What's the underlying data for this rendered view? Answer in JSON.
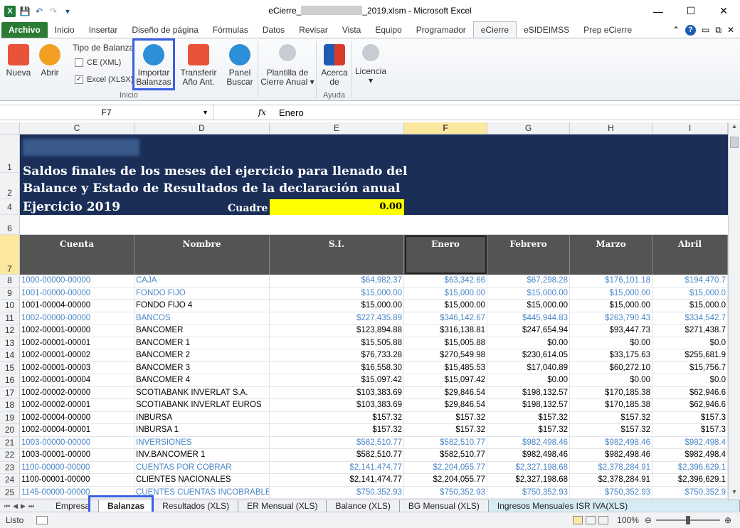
{
  "titlebar": {
    "title_prefix": "eCierre_",
    "title_suffix": "_2019.xlsm - Microsoft Excel",
    "min": "—",
    "max": "☐",
    "close": "✕"
  },
  "tabs": [
    "Archivo",
    "Inicio",
    "Insertar",
    "Diseño de página",
    "Fórmulas",
    "Datos",
    "Revisar",
    "Vista",
    "Equipo",
    "Programador",
    "eCierre",
    "eSIDEIMSS",
    "Prep eCierre"
  ],
  "ribbon": {
    "nueva": "Nueva",
    "abrir": "Abrir",
    "tipo_balanza": "Tipo de Balanza",
    "ce_xml": "CE (XML)",
    "excel_xlsx": "Excel (XLSX)",
    "inicio_group": "Inicio",
    "importar_l1": "Importar",
    "importar_l2": "Balanzas",
    "transferir_l1": "Transferir",
    "transferir_l2": "Año Ant.",
    "panel_l1": "Panel",
    "panel_l2": "Buscar",
    "plantilla_l1": "Plantilla de",
    "plantilla_l2": "Cierre Anual",
    "acerca_l1": "Acerca",
    "acerca_l2": "de",
    "ayuda_group": "Ayuda",
    "licencia": "Licencia"
  },
  "formula_bar": {
    "namebox": "F7",
    "fx": "fx",
    "value": "Enero"
  },
  "columns": [
    "C",
    "D",
    "E",
    "F",
    "G",
    "H",
    "I"
  ],
  "banner": {
    "line1": "Saldos finales de los meses del ejercicio para llenado del",
    "line2": "Balance y Estado de Resultados de la declaración anual",
    "ejercicio": "Ejercicio 2019",
    "cuadre_label": "Cuadre",
    "cuadre_value": "0.00"
  },
  "table_headers": [
    "Cuenta",
    "Nombre",
    "S.I.",
    "Enero",
    "Febrero",
    "Marzo",
    "Abril"
  ],
  "rows": [
    {
      "n": "8",
      "c": "1000-00000-00000",
      "d": "CAJA",
      "e": "$64,982.37",
      "f": "$63,342.66",
      "g": "$67,298.28",
      "h": "$176,101.18",
      "i": "$194,470.7",
      "blue": true
    },
    {
      "n": "9",
      "c": "1001-00000-00000",
      "d": "FONDO FIJO",
      "e": "$15,000.00",
      "f": "$15,000.00",
      "g": "$15,000.00",
      "h": "$15,000.00",
      "i": "$15,000.0",
      "blue": true
    },
    {
      "n": "10",
      "c": "1001-00004-00000",
      "d": "FONDO FIJO 4",
      "e": "$15,000.00",
      "f": "$15,000.00",
      "g": "$15,000.00",
      "h": "$15,000.00",
      "i": "$15,000.0",
      "blue": false
    },
    {
      "n": "11",
      "c": "1002-00000-00000",
      "d": "BANCOS",
      "e": "$227,435.89",
      "f": "$346,142.67",
      "g": "$445,944.83",
      "h": "$263,790.43",
      "i": "$334,542.7",
      "blue": true
    },
    {
      "n": "12",
      "c": "1002-00001-00000",
      "d": "BANCOMER",
      "e": "$123,894.88",
      "f": "$316,138.81",
      "g": "$247,654.94",
      "h": "$93,447.73",
      "i": "$271,438.7",
      "blue": false
    },
    {
      "n": "13",
      "c": "1002-00001-00001",
      "d": "BANCOMER 1",
      "e": "$15,505.88",
      "f": "$15,005.88",
      "g": "$0.00",
      "h": "$0.00",
      "i": "$0.0",
      "blue": false
    },
    {
      "n": "14",
      "c": "1002-00001-00002",
      "d": "BANCOMER 2",
      "e": "$76,733.28",
      "f": "$270,549.98",
      "g": "$230,614.05",
      "h": "$33,175.63",
      "i": "$255,681.9",
      "blue": false
    },
    {
      "n": "15",
      "c": "1002-00001-00003",
      "d": "BANCOMER 3",
      "e": "$16,558.30",
      "f": "$15,485.53",
      "g": "$17,040.89",
      "h": "$60,272.10",
      "i": "$15,756.7",
      "blue": false
    },
    {
      "n": "16",
      "c": "1002-00001-00004",
      "d": "BANCOMER 4",
      "e": "$15,097.42",
      "f": "$15,097.42",
      "g": "$0.00",
      "h": "$0.00",
      "i": "$0.0",
      "blue": false
    },
    {
      "n": "17",
      "c": "1002-00002-00000",
      "d": "SCOTIABANK INVERLAT S.A.",
      "e": "$103,383.69",
      "f": "$29,846.54",
      "g": "$198,132.57",
      "h": "$170,185.38",
      "i": "$62,946.6",
      "blue": false
    },
    {
      "n": "18",
      "c": "1002-00002-00001",
      "d": "SCOTIABANK INVERLAT EUROS",
      "e": "$103,383.69",
      "f": "$29,846.54",
      "g": "$198,132.57",
      "h": "$170,185.38",
      "i": "$62,946.6",
      "blue": false
    },
    {
      "n": "19",
      "c": "1002-00004-00000",
      "d": "INBURSA",
      "e": "$157.32",
      "f": "$157.32",
      "g": "$157.32",
      "h": "$157.32",
      "i": "$157.3",
      "blue": false
    },
    {
      "n": "20",
      "c": "1002-00004-00001",
      "d": "INBURSA 1",
      "e": "$157.32",
      "f": "$157.32",
      "g": "$157.32",
      "h": "$157.32",
      "i": "$157.3",
      "blue": false
    },
    {
      "n": "21",
      "c": "1003-00000-00000",
      "d": "INVERSIONES",
      "e": "$582,510.77",
      "f": "$582,510.77",
      "g": "$982,498.46",
      "h": "$982,498.46",
      "i": "$982,498.4",
      "blue": true
    },
    {
      "n": "22",
      "c": "1003-00001-00000",
      "d": "INV.BANCOMER 1",
      "e": "$582,510.77",
      "f": "$582,510.77",
      "g": "$982,498.46",
      "h": "$982,498.46",
      "i": "$982,498.4",
      "blue": false
    },
    {
      "n": "23",
      "c": "1100-00000-00000",
      "d": "CUENTAS POR COBRAR",
      "e": "$2,141,474.77",
      "f": "$2,204,055.77",
      "g": "$2,327,198.68",
      "h": "$2,378,284.91",
      "i": "$2,396,629.1",
      "blue": true
    },
    {
      "n": "24",
      "c": "1100-00001-00000",
      "d": "CLIENTES NACIONALES",
      "e": "$2,141,474.77",
      "f": "$2,204,055.77",
      "g": "$2,327,198.68",
      "h": "$2,378,284.91",
      "i": "$2,396,629.1",
      "blue": false
    },
    {
      "n": "25",
      "c": "1145-00000-00000",
      "d": "CUENTES CUENTAS INCOBRABLES",
      "e": "$750,352.93",
      "f": "$750,352.93",
      "g": "$750,352.93",
      "h": "$750,352.93",
      "i": "$750,352.9",
      "blue": true
    }
  ],
  "sheet_tabs": [
    "Empresa",
    "Balanzas",
    "Resultados (XLS)",
    "ER Mensual (XLS)",
    "Balance (XLS)",
    "BG Mensual (XLS)",
    "Ingresos Mensuales ISR IVA(XLS)"
  ],
  "status": {
    "ready": "Listo",
    "zoom": "100%"
  }
}
